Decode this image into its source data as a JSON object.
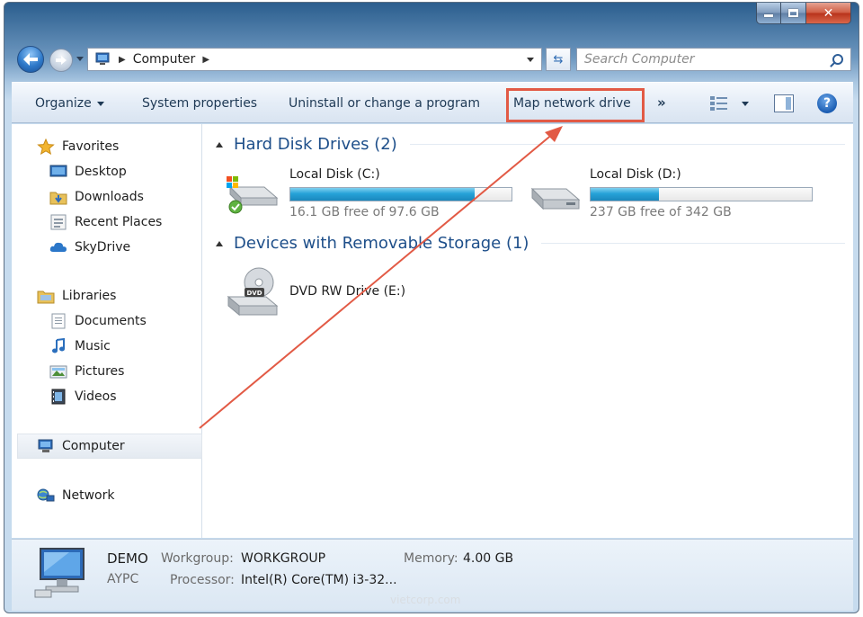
{
  "address": {
    "crumbs": [
      "Computer"
    ]
  },
  "search": {
    "placeholder": "Search Computer"
  },
  "command_bar": {
    "organize": "Organize",
    "system_properties": "System properties",
    "uninstall": "Uninstall or change a program",
    "map_network_drive": "Map network drive",
    "more": "»"
  },
  "sidebar": {
    "favorites": {
      "label": "Favorites",
      "items": [
        "Desktop",
        "Downloads",
        "Recent Places",
        "SkyDrive"
      ]
    },
    "libraries": {
      "label": "Libraries",
      "items": [
        "Documents",
        "Music",
        "Pictures",
        "Videos"
      ]
    },
    "computer": "Computer",
    "network": "Network"
  },
  "groups": {
    "hard_disks": {
      "title": "Hard Disk Drives (2)"
    },
    "removable": {
      "title": "Devices with Removable Storage (1)"
    }
  },
  "drives": [
    {
      "name": "Local Disk (C:)",
      "free_text": "16.1 GB free of 97.6 GB",
      "used_fraction": 0.835
    },
    {
      "name": "Local Disk (D:)",
      "free_text": "237 GB free of 342 GB",
      "used_fraction": 0.307
    }
  ],
  "removable": {
    "name": "DVD RW Drive (E:)",
    "icon_label": "DVD"
  },
  "status": {
    "computer_name": "DEMO",
    "workgroup_label": "Workgroup:",
    "workgroup": "WORKGROUP",
    "memory_label": "Memory:",
    "memory": "4.00 GB",
    "subname": "AYPC",
    "processor_label": "Processor:",
    "processor": "Intel(R) Core(TM) i3-32..."
  },
  "watermark": "vietcorp.com",
  "colors": {
    "highlight": "#e25a45",
    "bar_fill": "#26a2d8",
    "group_title": "#1e4f8a"
  }
}
